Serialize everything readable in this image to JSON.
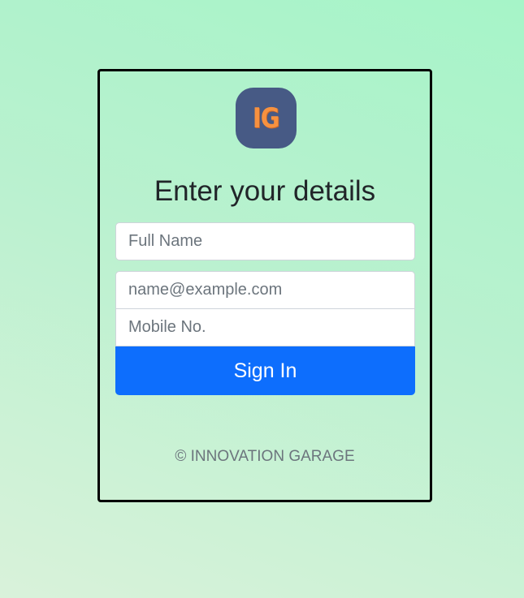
{
  "logo": {
    "text": "IG",
    "colors": {
      "background": "#475a85",
      "letters": "#f7913f"
    }
  },
  "form": {
    "title": "Enter your details",
    "full_name": {
      "placeholder": "Full Name",
      "value": ""
    },
    "email": {
      "placeholder": "name@example.com",
      "value": ""
    },
    "mobile": {
      "placeholder": "Mobile No.",
      "value": ""
    },
    "submit_label": "Sign In"
  },
  "footer": {
    "text": "© INNOVATION GARAGE"
  },
  "colors": {
    "accent": "#0d6efd",
    "border": "#000000"
  }
}
